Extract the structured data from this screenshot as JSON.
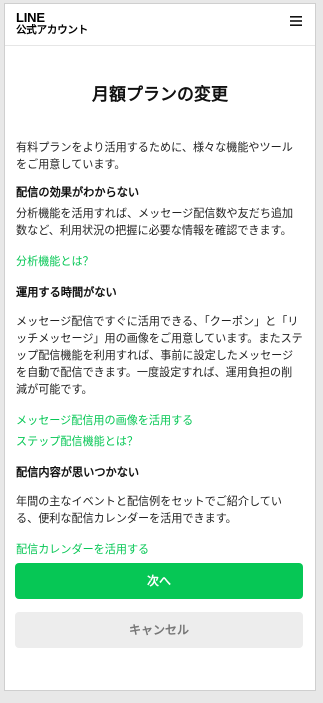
{
  "header": {
    "logo_line1": "LINE",
    "logo_line2": "公式アカウント",
    "menu_icon": "hamburger-menu-icon"
  },
  "page": {
    "title": "月額プランの変更"
  },
  "content": {
    "intro": "有料プランをより活用するために、様々な機能やツールをご用意しています。",
    "sections": [
      {
        "heading": "配信の効果がわからない",
        "body": "分析機能を活用すれば、メッセージ配信数や友だち追加数など、利用状況の把握に必要な情報を確認できます。",
        "links": [
          "分析機能とは？"
        ]
      },
      {
        "heading": "運用する時間がない",
        "body": "メッセージ配信ですぐに活用できる、「クーポン」と「リッチメッセージ」用の画像をご用意しています。またステップ配信機能を利用すれば、事前に設定したメッセージを自動で配信できます。一度設定すれば、運用負担の削減が可能です。",
        "links": [
          "メッセージ配信用の画像を活用する",
          "ステップ配信機能とは？"
        ]
      },
      {
        "heading": "配信内容が思いつかない",
        "body": "年間の主なイベントと配信例をセットでご紹介している、便利な配信カレンダーを活用できます。",
        "links": [
          "配信カレンダーを活用する"
        ]
      }
    ]
  },
  "actions": {
    "next_label": "次へ",
    "cancel_label": "キャンセル"
  },
  "colors": {
    "accent": "#06c755",
    "cancel_bg": "#ededed"
  }
}
